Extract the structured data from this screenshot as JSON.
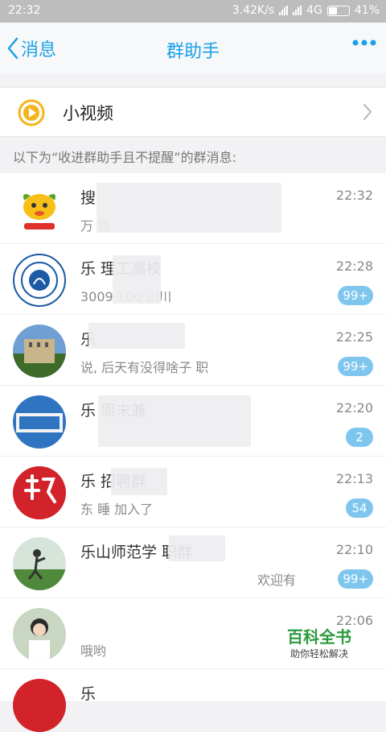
{
  "status_bar": {
    "time": "22:32",
    "speed": "3.42K/s",
    "network": "4G",
    "battery": "41%"
  },
  "nav": {
    "back_label": "消息",
    "title": "群助手"
  },
  "video_row": {
    "label": "小视频"
  },
  "hint": "以下为“收进群助手且不提醒”的群消息:",
  "conversations": [
    {
      "title": "搜",
      "preview": "万 我",
      "time": "22:32",
      "badge": ""
    },
    {
      "title": "乐 理工高校",
      "preview": "3009 100 山川",
      "time": "22:28",
      "badge": "99+"
    },
    {
      "title": "乐",
      "preview": "说, 后天有没得啥子 职",
      "time": "22:25",
      "badge": "99+"
    },
    {
      "title": "乐 周末兼",
      "preview": "",
      "time": "22:20",
      "badge": "2"
    },
    {
      "title": "乐 招聘群",
      "preview": "东 睡 加入了",
      "time": "22:13",
      "badge": "54"
    },
    {
      "title": "乐山师范学 职群",
      "preview": "欢迎有",
      "time": "22:10",
      "badge": "99+"
    },
    {
      "title": "",
      "preview": "哦哟",
      "time": "22:06",
      "badge": ""
    },
    {
      "title": "乐",
      "preview": "",
      "time": "",
      "badge": ""
    }
  ],
  "watermark": {
    "brand": "百科全书",
    "tagline": "助你轻松解决"
  },
  "colors": {
    "accent": "#1aa1e8",
    "badge": "#7fc6ef",
    "video_icon": "#f5b51c"
  }
}
